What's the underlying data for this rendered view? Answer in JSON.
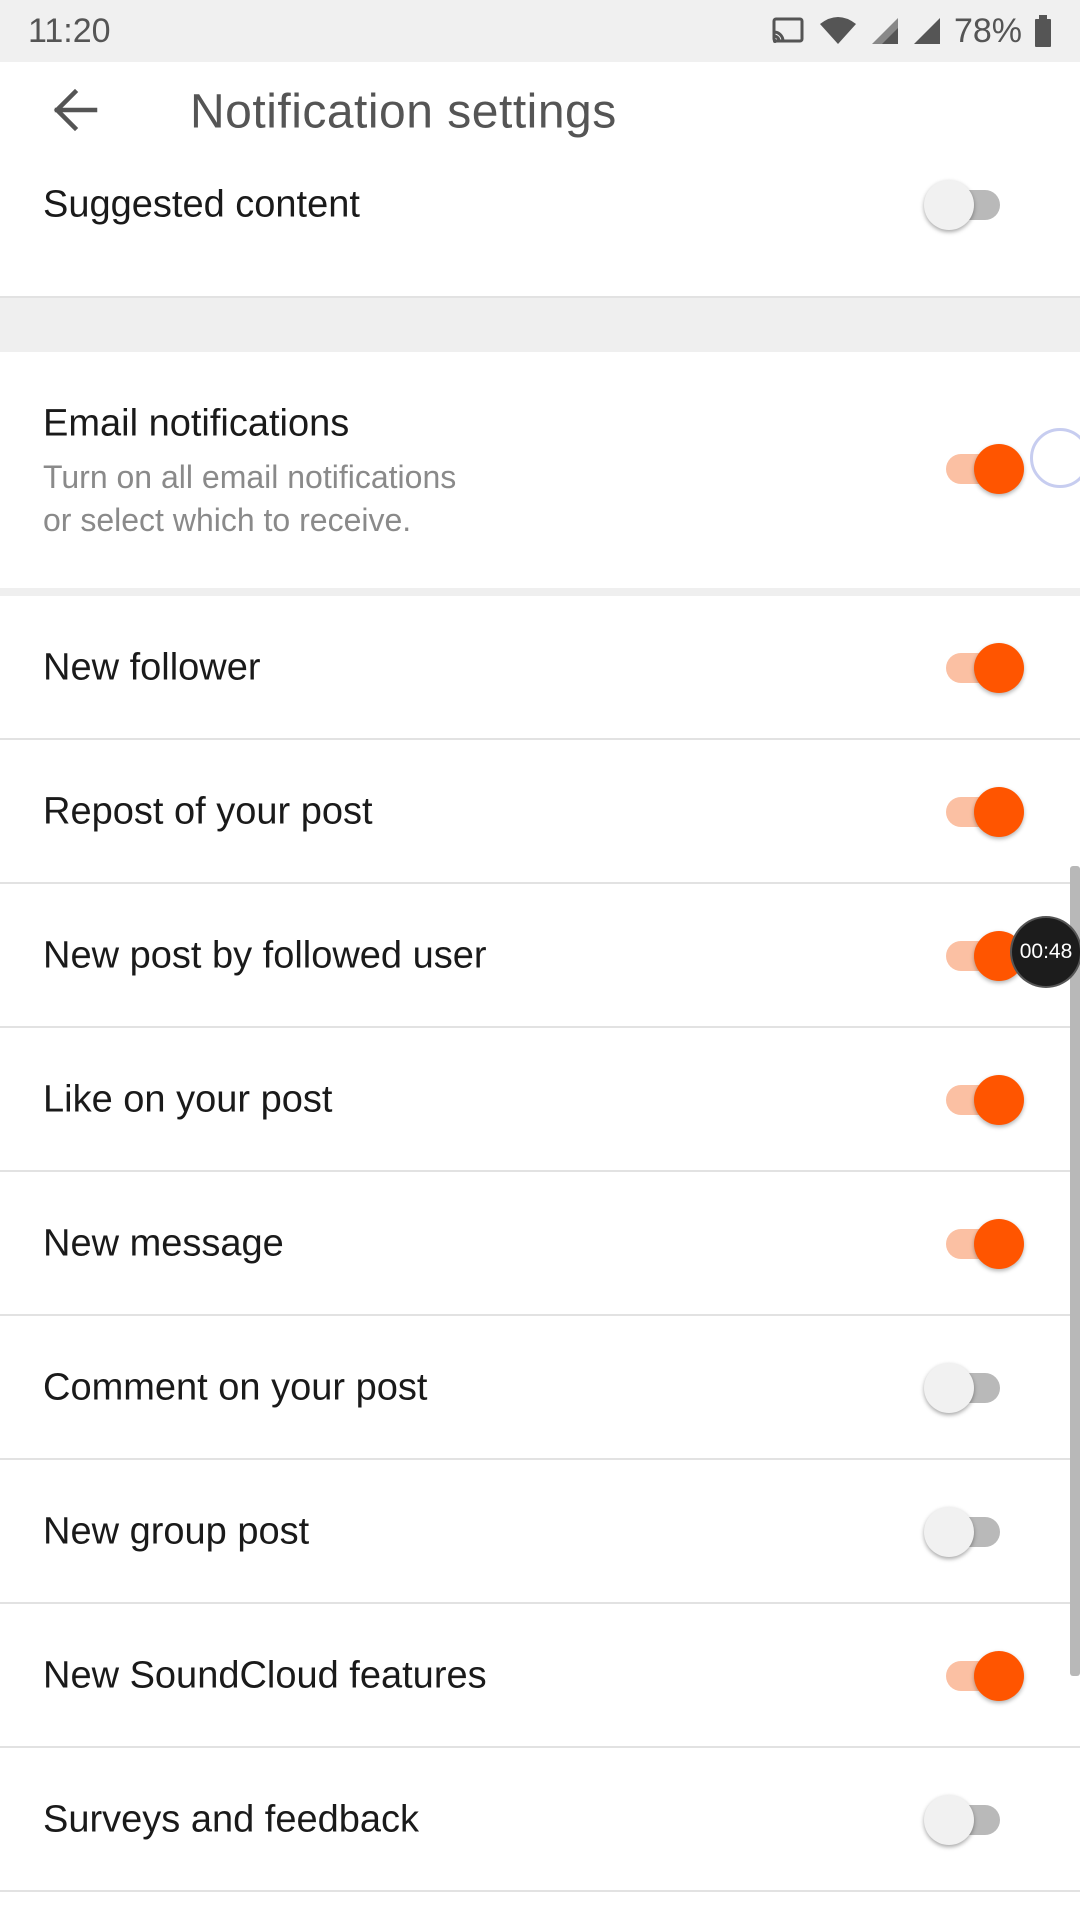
{
  "status_bar": {
    "time": "11:20",
    "battery": "78%",
    "icons": [
      "cast-icon",
      "wifi-icon",
      "signal-icon",
      "signal-icon",
      "battery-icon"
    ]
  },
  "header": {
    "title": "Notification settings",
    "back_icon": "arrow-left-icon"
  },
  "suggested": {
    "label": "Suggested content",
    "enabled": false
  },
  "email": {
    "label": "Email notifications",
    "subtitle_line1": "Turn on all email notifications",
    "subtitle_line2": "or select which to receive.",
    "enabled": true
  },
  "items": [
    {
      "label": "New follower",
      "enabled": true
    },
    {
      "label": "Repost of your post",
      "enabled": true
    },
    {
      "label": "New post by followed user",
      "enabled": true
    },
    {
      "label": "Like on your post",
      "enabled": true
    },
    {
      "label": "New message",
      "enabled": true
    },
    {
      "label": "Comment on your post",
      "enabled": false
    },
    {
      "label": "New group post",
      "enabled": false
    },
    {
      "label": "New SoundCloud features",
      "enabled": true
    },
    {
      "label": "Surveys and feedback",
      "enabled": false
    }
  ],
  "overlay": {
    "timer": "00:48"
  },
  "colors": {
    "accent": "#ff5500",
    "accent_track": "#fbc0a3",
    "off_thumb": "#f1f1f1",
    "off_track": "#b9b9b9"
  }
}
